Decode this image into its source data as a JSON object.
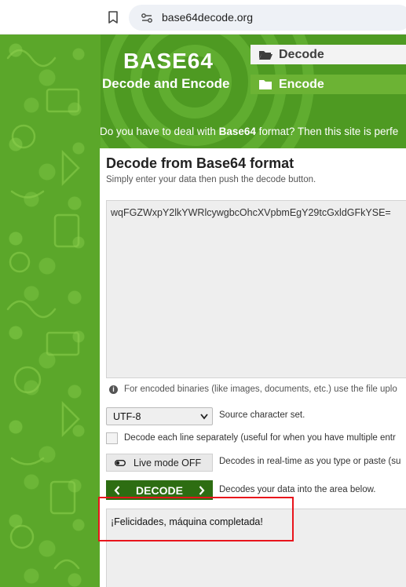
{
  "browser": {
    "url": "base64decode.org"
  },
  "header": {
    "logo_title": "BASE64",
    "logo_subtitle": "Decode and Encode",
    "nav": [
      {
        "label": "Decode",
        "icon": "folder-open-icon",
        "active": true
      },
      {
        "label": "Encode",
        "icon": "folder-icon",
        "active": false
      }
    ],
    "tagline_prefix": "Do you have to deal with ",
    "tagline_bold": "Base64",
    "tagline_suffix": " format? Then this site is perfe"
  },
  "decoder": {
    "title": "Decode from Base64 format",
    "hint": "Simply enter your data then push the decode button.",
    "input_value": "wqFGZWxpY2lkYWRlcywgbcOhcXVpbmEgY29tcGxldGFkYSE=",
    "info_note": "For encoded binaries (like images, documents, etc.) use the file uplo",
    "charset_value": "UTF-8",
    "charset_label": "Source character set.",
    "per_line_label": "Decode each line separately (useful for when you have multiple entr",
    "live_mode_label": "Live mode OFF",
    "live_mode_desc": "Decodes in real-time as you type or paste (su",
    "decode_button": "DECODE",
    "decode_desc": "Decodes your data into the area below.",
    "output_value": "¡Felicidades, máquina completada!"
  },
  "colors": {
    "page_green": "#58a529",
    "decode_button": "#2d6d12",
    "highlight_red": "#e8141c"
  }
}
